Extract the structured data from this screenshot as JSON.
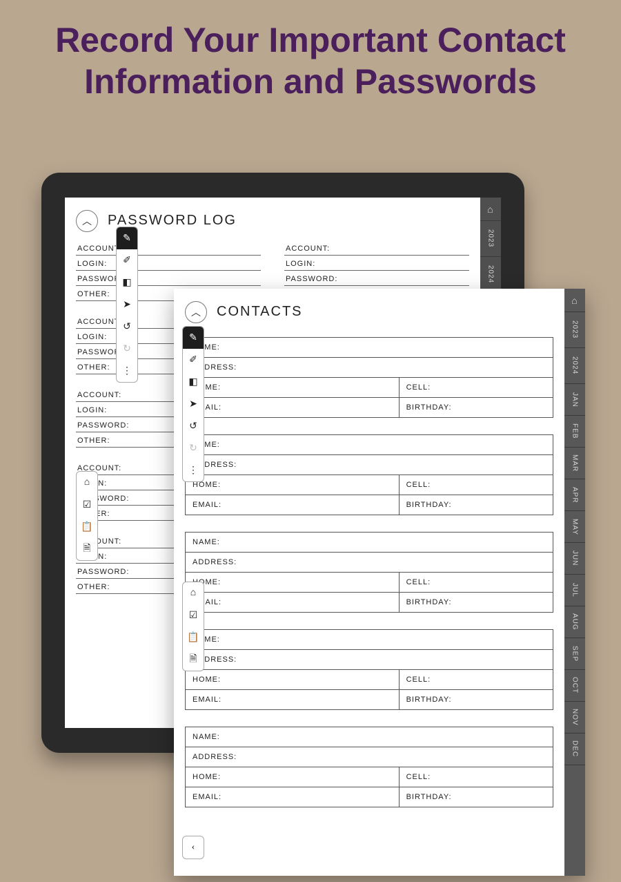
{
  "hero": {
    "title": "Record Your Important Contact Information and Passwords"
  },
  "passwordPage": {
    "title": "PASSWORD LOG",
    "fields": {
      "account": "ACCOUNT:",
      "login": "LOGIN:",
      "password": "PASSWORD:",
      "other": "OTHER:"
    },
    "tabs": {
      "home": "⌂",
      "years": [
        "2023",
        "2024"
      ]
    }
  },
  "contactsPage": {
    "title": "CONTACTS",
    "fields": {
      "name": "NAME:",
      "address": "ADDRESS:",
      "home": "HOME:",
      "cell": "CELL:",
      "email": "EMAIL:",
      "birthday": "BIRTHDAY:"
    },
    "tabs": {
      "home": "⌂",
      "years": [
        "2023",
        "2024"
      ],
      "months": [
        "JAN",
        "FEB",
        "MAR",
        "APR",
        "MAY",
        "JUN",
        "JUL",
        "AUG",
        "SEP",
        "OCT",
        "NOV",
        "DEC"
      ]
    }
  },
  "toolbar": {
    "pen": "✎",
    "highlighter": "✐",
    "eraser": "◧",
    "pointer": "➤",
    "undo": "↺",
    "redo": "↻",
    "more": "⋮",
    "homeIcon": "⌂",
    "checkIcon": "☑",
    "clipboardIcon": "📋",
    "docIcon": "🗎",
    "backIcon": "‹"
  },
  "glyph": {
    "chevUp": "︿"
  }
}
